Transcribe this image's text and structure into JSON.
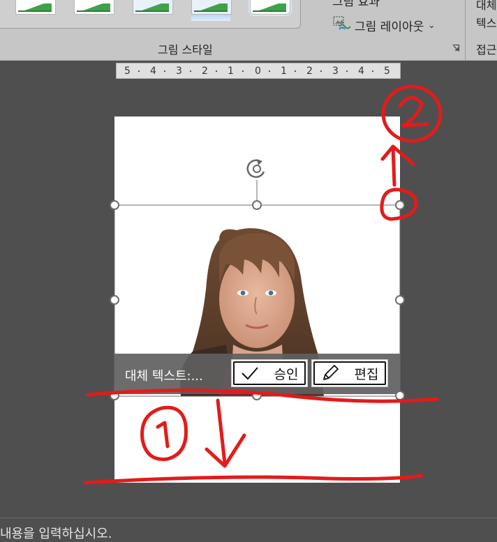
{
  "ribbon": {
    "menu_item_cutoff": "그림 효과 ˅",
    "picture_layout_label": "그림 레이아웃",
    "picture_style_group": "그림 스타일",
    "right_top_text": "대체",
    "right_mid_text": "텍스",
    "right_group_label": "접근"
  },
  "ruler": {
    "ticks": [
      "5",
      "4",
      "3",
      "2",
      "1",
      "0",
      "1",
      "2",
      "3",
      "4",
      "5"
    ]
  },
  "alt_text": {
    "label": "대체 텍스트:...",
    "approve_label": "승인",
    "edit_label": "편집"
  },
  "annotations": {
    "circle_one": "①",
    "circle_two": "②",
    "annotation_color": "#e31b1b"
  },
  "status": {
    "text": "내용을 입력하십시오."
  },
  "icons": [
    "rotate-handle-icon",
    "check-icon",
    "pencil-icon",
    "picture-layout-icon",
    "dialog-launcher-icon",
    "chevron-down-icon"
  ]
}
